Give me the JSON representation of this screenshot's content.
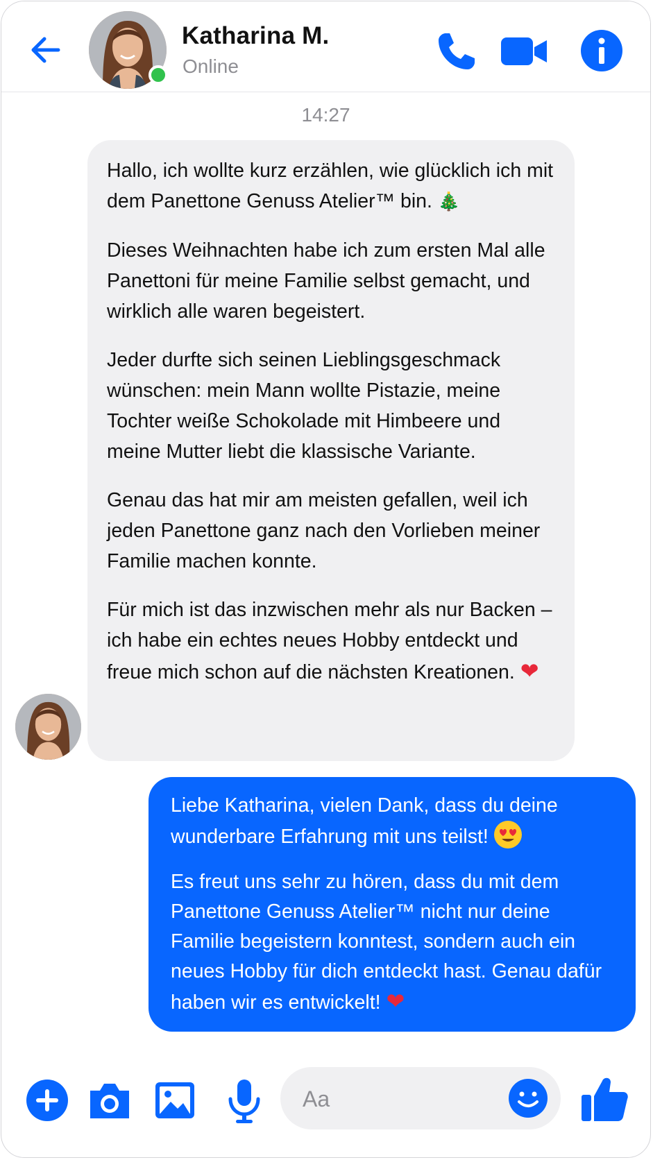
{
  "header": {
    "contact_name": "Katharina M.",
    "status": "Online"
  },
  "timestamp": "14:27",
  "incoming": {
    "paragraphs": [
      "Hallo, ich wollte kurz erzählen, wie glücklich ich mit dem Panettone Genuss Atelier™ bin.",
      "Dieses Weihnachten habe ich zum ersten Mal alle Panettoni für meine Familie selbst gemacht, und wirklich alle waren begeistert.",
      "Jeder durfte sich seinen Lieblingsgeschmack wünschen: mein Mann wollte Pistazie, meine Tochter weiße Schokolade mit Himbeere und meine Mutter liebt die klassische Variante.",
      "Genau das hat mir am meisten gefallen, weil ich jeden Panettone ganz nach den Vorlieben meiner Familie machen konnte.",
      "Für mich ist das inzwischen mehr als nur Backen – ich habe ein echtes neues Hobby entdeckt und freue mich schon auf die nächsten Kreationen."
    ],
    "emoji_1": "🎄",
    "emoji_5": "❤"
  },
  "outgoing": {
    "paragraphs": [
      "Liebe Katharina, vielen Dank, dass du deine wunderbare Erfahrung mit uns teilst!",
      "Es freut uns sehr zu hören, dass du mit dem Panettone Genuss Atelier™ nicht nur deine Familie begeistern konntest, sondern auch ein neues Hobby für dich entdeckt hast. Genau dafür haben wir es entwickelt!"
    ],
    "emoji_2": "❤"
  },
  "composer": {
    "placeholder": "Aa"
  },
  "colors": {
    "accent": "#0866ff",
    "incoming_bubble": "#f0f0f2",
    "online": "#31c24d"
  },
  "icons": [
    "back-arrow-icon",
    "phone-icon",
    "video-camera-icon",
    "info-icon",
    "plus-icon",
    "camera-icon",
    "image-icon",
    "microphone-icon",
    "smiley-icon",
    "thumbs-up-icon"
  ]
}
